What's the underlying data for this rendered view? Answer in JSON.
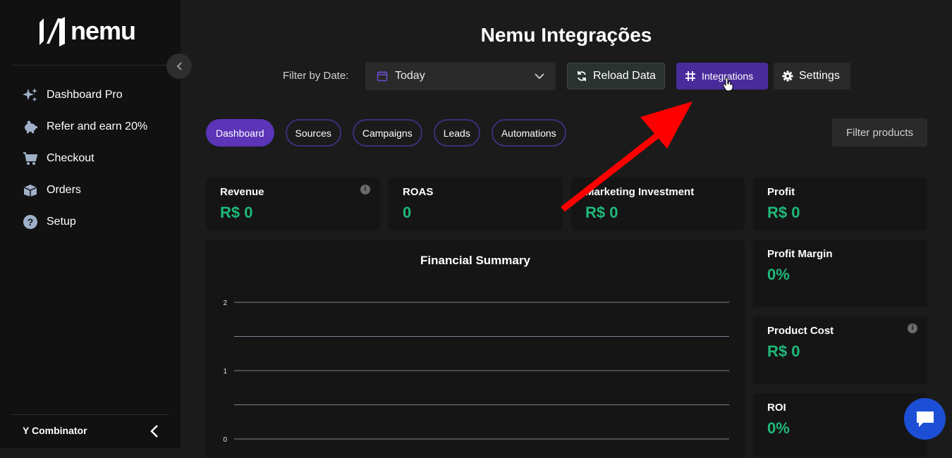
{
  "brand": {
    "name": "nemu"
  },
  "sidebar": {
    "items": [
      {
        "label": "Dashboard Pro",
        "icon": "sparkles-icon"
      },
      {
        "label": "Refer and earn 20%",
        "icon": "piggy-bank-icon"
      },
      {
        "label": "Checkout",
        "icon": "cart-icon"
      },
      {
        "label": "Orders",
        "icon": "box-icon"
      },
      {
        "label": "Setup",
        "icon": "question-icon"
      }
    ],
    "organization": "Y Combinator"
  },
  "header": {
    "title": "Nemu Integrações",
    "filter_label": "Filter by Date:",
    "date_value": "Today",
    "reload_label": "Reload Data",
    "integrations_label": "Integrations",
    "settings_label": "Settings"
  },
  "tabs": [
    {
      "label": "Dashboard",
      "active": true
    },
    {
      "label": "Sources",
      "active": false
    },
    {
      "label": "Campaigns",
      "active": false
    },
    {
      "label": "Leads",
      "active": false
    },
    {
      "label": "Automations",
      "active": false
    }
  ],
  "filter_products_label": "Filter products",
  "metrics": {
    "revenue": {
      "label": "Revenue",
      "value": "R$ 0"
    },
    "roas": {
      "label": "ROAS",
      "value": "0"
    },
    "marketing": {
      "label": "Marketing Investment",
      "value": "R$ 0"
    },
    "profit": {
      "label": "Profit",
      "value": "R$ 0"
    },
    "profit_margin": {
      "label": "Profit Margin",
      "value": "0%"
    },
    "product_cost": {
      "label": "Product Cost",
      "value": "R$ 0"
    },
    "roi": {
      "label": "ROI",
      "value": "0%"
    }
  },
  "chart_data": {
    "type": "line",
    "title": "Financial Summary",
    "ylim": [
      0,
      2
    ],
    "yticks": [
      "0",
      "1",
      "2"
    ],
    "grid": true
  },
  "colors": {
    "accent": "#5b34b8",
    "positive": "#1fb97a",
    "annotation_arrow": "#ff0000",
    "chat": "#1d4fd6"
  }
}
